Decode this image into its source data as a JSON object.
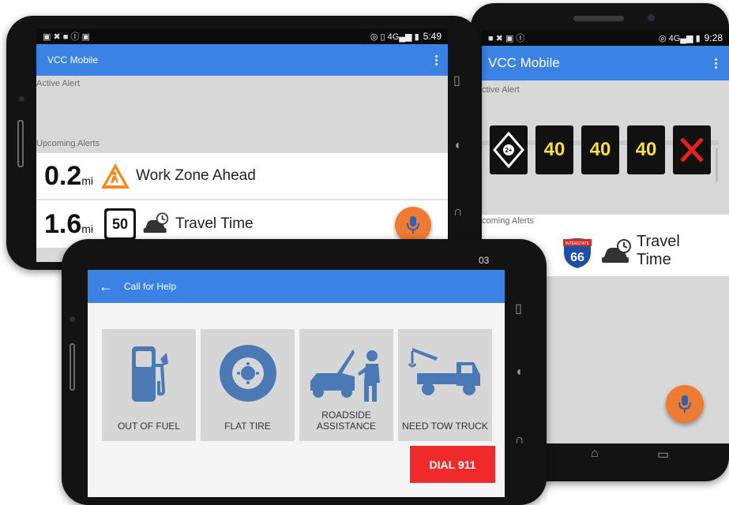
{
  "back_phone": {
    "status": {
      "icons": "■ ✖ ▣ Ⓘ",
      "network": "◎ 4G▄▆ ▮",
      "time": "9:28"
    },
    "app_title": "VCC Mobile",
    "active_label": "ctive Alert",
    "signs": [
      "40",
      "40",
      "40"
    ],
    "upcoming_label": "coming Alerts",
    "travel_label_line1": "Travel",
    "travel_label_line2": "Time",
    "shield_top": "INTERSTATE",
    "shield_number": "66"
  },
  "front_phone": {
    "status": {
      "icons": "▣ ✖ ■ Ⓘ ▣",
      "network": "◎ ▯ 4G▄▆ ▮",
      "time": "5:49"
    },
    "app_title": "VCC Mobile",
    "active_label": "Active Alert",
    "upcoming_label": "Upcoming Alerts",
    "alerts": [
      {
        "distance": "0.2",
        "unit": "mi",
        "label": "Work Zone Ahead"
      },
      {
        "distance": "1.6",
        "unit": "mi",
        "label": "Travel Time",
        "sign": "50"
      }
    ]
  },
  "bottom_phone": {
    "status_time": "03",
    "title": "Call for Help",
    "tiles": [
      {
        "label": "OUT OF FUEL",
        "icon": "fuel-pump-icon"
      },
      {
        "label": "FLAT TIRE",
        "icon": "tire-icon"
      },
      {
        "label": "ROADSIDE\nASSISTANCE",
        "label_line1": "ROADSIDE",
        "label_line2": "ASSISTANCE",
        "icon": "mechanic-icon"
      },
      {
        "label": "NEED TOW TRUCK",
        "icon": "tow-truck-icon"
      }
    ],
    "dial_label": "DIAL 911"
  },
  "colors": {
    "appbar": "#3b82e4",
    "fab": "#ef7a31",
    "dial": "#f02a2a",
    "sign_digits": "#f7e03a",
    "icon_blue": "#4a79b5"
  }
}
